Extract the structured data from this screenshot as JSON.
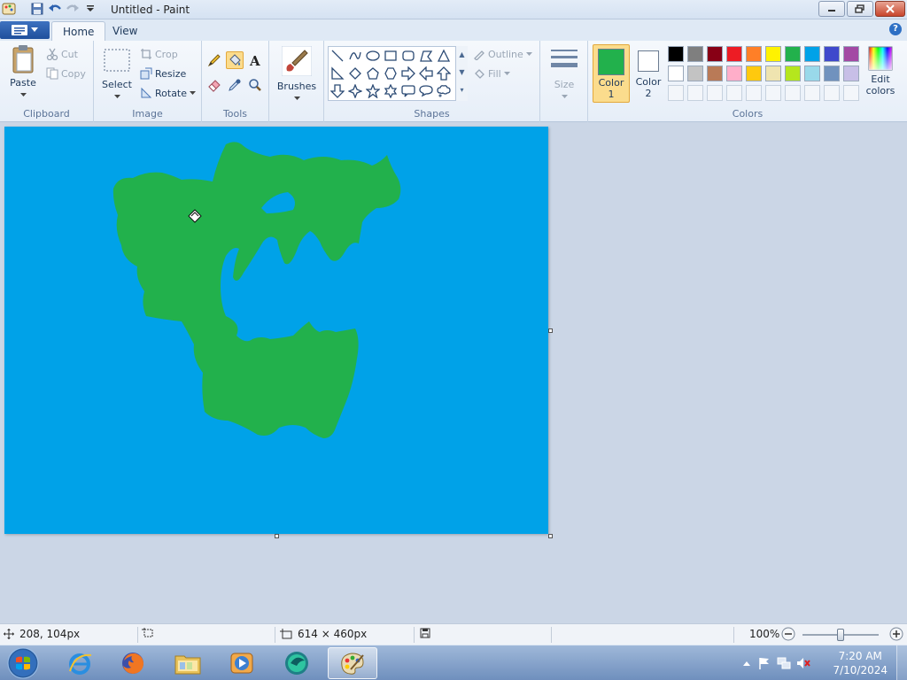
{
  "window": {
    "title": "Untitled - Paint"
  },
  "tabs": {
    "home": "Home",
    "view": "View"
  },
  "clipboard": {
    "paste": "Paste",
    "cut": "Cut",
    "copy": "Copy",
    "label": "Clipboard"
  },
  "image": {
    "select": "Select",
    "crop": "Crop",
    "resize": "Resize",
    "rotate": "Rotate",
    "label": "Image"
  },
  "tools": {
    "label": "Tools"
  },
  "brushes": {
    "label": "Brushes"
  },
  "shapes": {
    "label": "Shapes",
    "outline": "Outline",
    "fill": "Fill"
  },
  "size": {
    "label": "Size"
  },
  "colors": {
    "color1_label": "Color",
    "color1_num": "1",
    "color2_label": "Color",
    "color2_num": "2",
    "edit_label": "Edit",
    "edit_label2": "colors",
    "label": "Colors",
    "color1_value": "#22b14c",
    "color2_value": "#ffffff",
    "palette_row1": [
      "#000000",
      "#7f7f7f",
      "#880015",
      "#ed1c24",
      "#ff7f27",
      "#fff200",
      "#22b14c",
      "#00a2e8",
      "#3f48cc",
      "#a349a4"
    ],
    "palette_row2": [
      "#ffffff",
      "#c3c3c3",
      "#b97a57",
      "#ffaec9",
      "#ffc90e",
      "#efe4b0",
      "#b5e61d",
      "#99d9ea",
      "#7092be",
      "#c8bfe7"
    ]
  },
  "canvas": {
    "background": "#00a2e8",
    "shape_color": "#22b14c"
  },
  "status": {
    "cursor_pos": "208, 104px",
    "canvas_size": "614 × 460px",
    "zoom": "100%"
  },
  "taskbar": {
    "time": "7:20 AM",
    "date": "7/10/2024"
  }
}
